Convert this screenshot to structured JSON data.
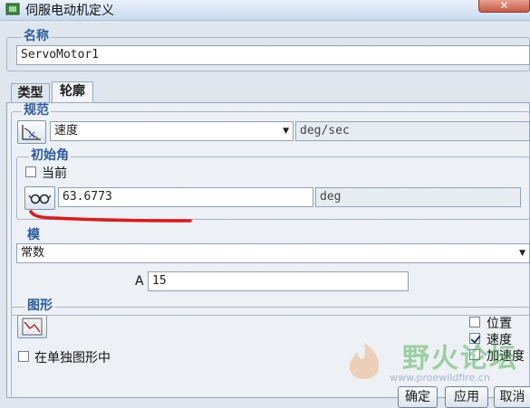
{
  "window": {
    "title": "伺服电动机定义"
  },
  "name_group": {
    "legend": "名称",
    "value": "ServoMotor1"
  },
  "tabs": [
    {
      "label": "类型",
      "active": false
    },
    {
      "label": "轮廓",
      "active": true
    }
  ],
  "spec_group": {
    "legend": "规范",
    "type_select": "速度",
    "unit": "deg/sec"
  },
  "initial_angle": {
    "legend": "初始角",
    "current_label": "当前",
    "current_checked": false,
    "value": "63.6773",
    "unit": "deg"
  },
  "mode_group": {
    "legend": "模",
    "select": "常数",
    "param_label": "A",
    "param_value": "15"
  },
  "graph_group": {
    "legend": "图形",
    "single_graph_label": "在单独图形中",
    "single_graph_checked": false,
    "options": [
      {
        "label": "位置",
        "checked": false
      },
      {
        "label": "速度",
        "checked": true
      },
      {
        "label": "加速度",
        "checked": false
      }
    ]
  },
  "buttons": {
    "ok": "确定",
    "apply": "应用",
    "cancel": "取消"
  },
  "watermark": {
    "text": "野火论坛",
    "url": "www.proewildfire.cn"
  },
  "colors": {
    "annotation": "#e01818",
    "legend": "#2a5aa8",
    "watermark": "#4caf50"
  }
}
